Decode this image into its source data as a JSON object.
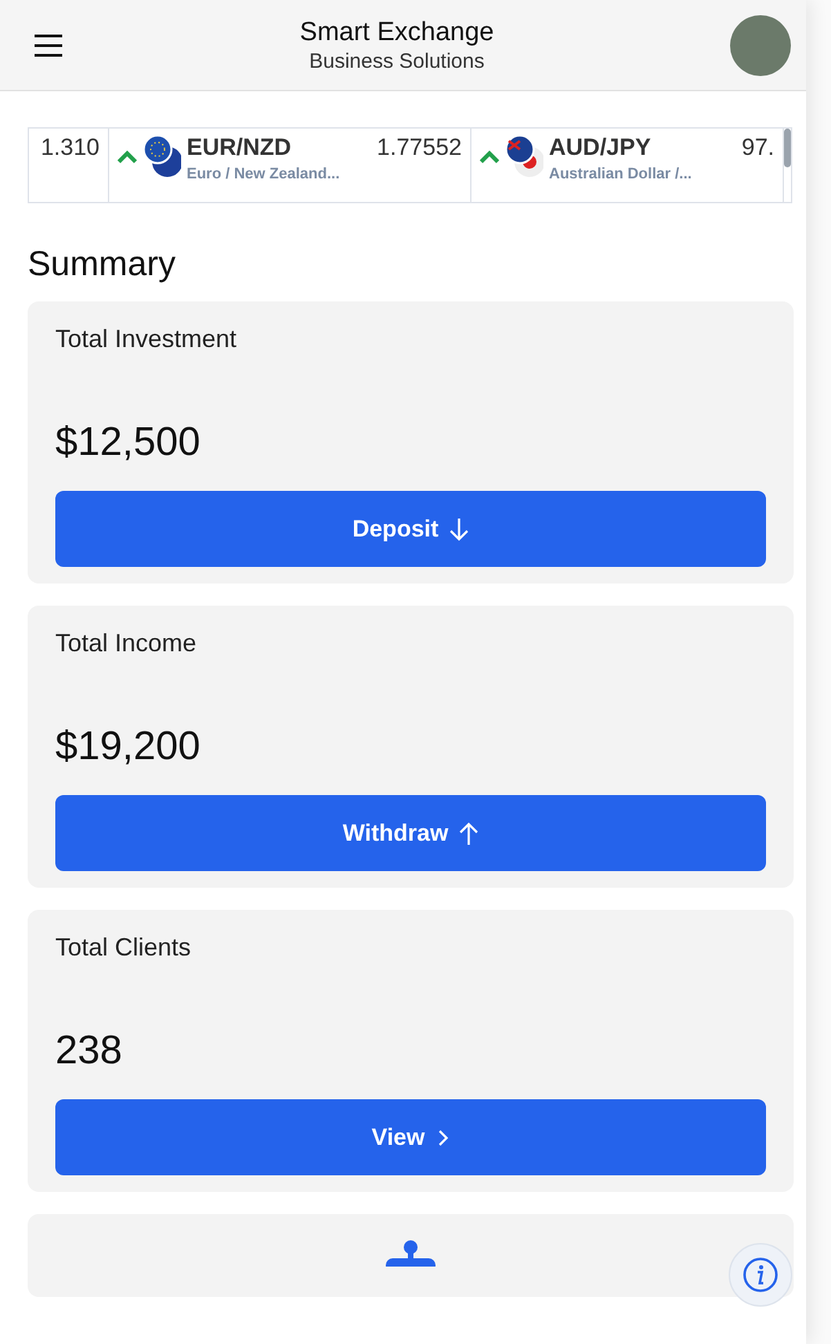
{
  "header": {
    "title": "Smart Exchange",
    "subtitle": "Business Solutions"
  },
  "ticker": [
    {
      "kind": "partial",
      "price": "1.310"
    },
    {
      "kind": "rising",
      "symbol": "EUR/NZD",
      "name": "Euro / New Zealand...",
      "price": "1.77552"
    },
    {
      "kind": "rising",
      "symbol": "AUD/JPY",
      "name": "Australian Dollar /...",
      "price": "97."
    }
  ],
  "summary": {
    "title": "Summary",
    "cards": [
      {
        "kind": "deposit",
        "label": "Total Investment",
        "value": "$12,500",
        "button": "Deposit"
      },
      {
        "kind": "withdraw",
        "label": "Total Income",
        "value": "$19,200",
        "button": "Withdraw"
      },
      {
        "kind": "view",
        "label": "Total Clients",
        "value": "238",
        "button": "View"
      }
    ]
  }
}
